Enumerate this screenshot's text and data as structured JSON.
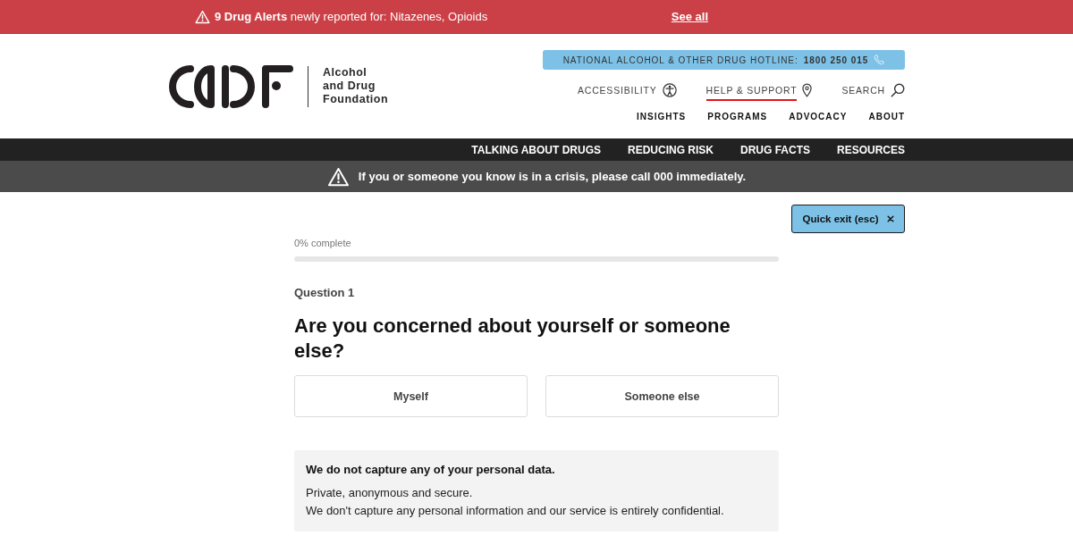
{
  "alert_bar": {
    "message": "**9 Drug Alerts** newly reported for: Nitazenes, Opioids",
    "link": "See all"
  },
  "header": {
    "logo_text": [
      "Alcohol",
      "and Drug",
      "Foundation"
    ],
    "hotline": "NATIONAL ALCOHOL & OTHER DRUG HOTLINE: **1800 250 015**",
    "utility_links": [
      {
        "label": "ACCESSIBILITY",
        "kind": "accessibility",
        "selected": false
      },
      {
        "label": "HELP & SUPPORT",
        "kind": "location",
        "selected": true
      },
      {
        "label": "SEARCH",
        "kind": "search",
        "selected": false
      }
    ],
    "nav": [
      "INSIGHTS",
      "PROGRAMS",
      "ADVOCACY",
      "ABOUT"
    ]
  },
  "main_nav": [
    "TALKING ABOUT DRUGS",
    "REDUCING RISK",
    "DRUG FACTS",
    "RESOURCES"
  ],
  "crisis_banner": {
    "message": "If you or someone you know is in a crisis, please call 000 immediately."
  },
  "quick_exit": {
    "label": "Quick exit (esc)"
  },
  "progress": {
    "label": "0% complete",
    "level": 0
  },
  "question": {
    "number": "Question 1",
    "title": "Are you concerned about yourself or someone else?",
    "options": [
      {
        "label": "Myself",
        "selected": false
      },
      {
        "label": "Someone else",
        "selected": false
      }
    ]
  },
  "privacy_notice": {
    "title": "We do not capture any of your personal data.",
    "lines": [
      "Private, anonymous and secure.",
      "We don't capture any personal information and our service is entirely confidential."
    ]
  }
}
